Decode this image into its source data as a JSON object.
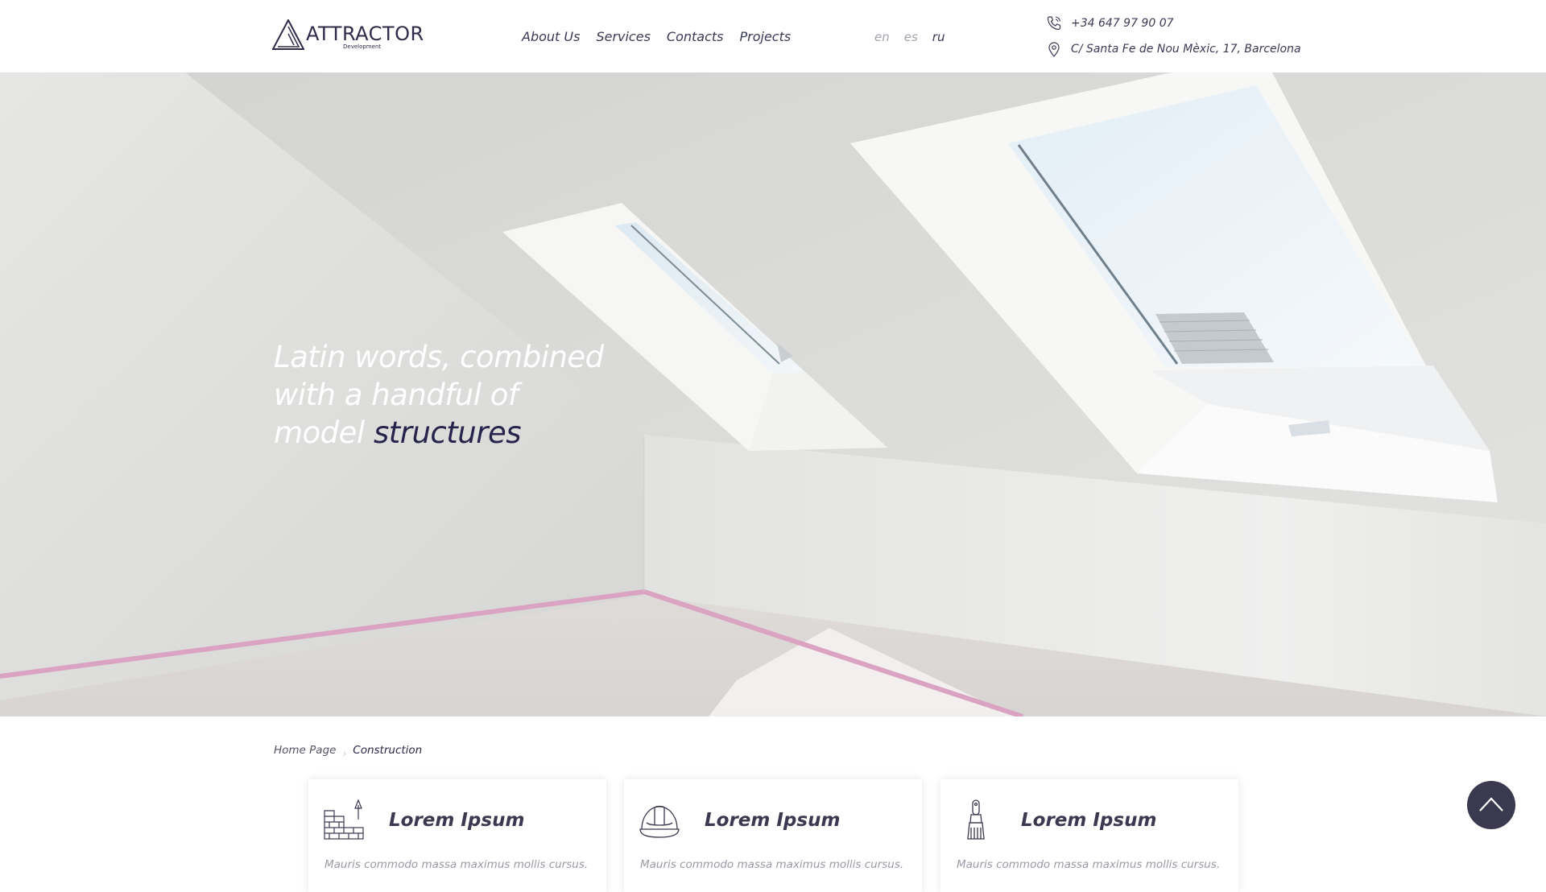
{
  "brand": {
    "name": "ATTRACTOR",
    "subtitle": "Development"
  },
  "nav": {
    "items": [
      {
        "label": "About Us"
      },
      {
        "label": "Services"
      },
      {
        "label": "Contacts"
      },
      {
        "label": "Projects"
      }
    ]
  },
  "languages": {
    "items": [
      {
        "code": "en"
      },
      {
        "code": "es"
      },
      {
        "code": "ru"
      }
    ],
    "active": "ru"
  },
  "contact": {
    "phone": "+34 647 97 90 07",
    "phone_icon": "phone-icon",
    "address": "C/ Santa Fe de Nou Mèxic, 17, Barcelona",
    "address_icon": "location-pin-icon"
  },
  "hero": {
    "line1": "Latin words, combined",
    "line2": "with a handful of",
    "line3_plain": "model",
    "line3_accent": "structures",
    "accent_color": "#26244a"
  },
  "breadcrumb": {
    "home": "Home Page",
    "current": "Construction"
  },
  "cards": [
    {
      "title": "Lorem Ipsum",
      "text": "Mauris commodo massa maximus mollis cursus.",
      "icon": "brick-wall-icon"
    },
    {
      "title": "Lorem Ipsum",
      "text": "Mauris commodo massa maximus mollis cursus.",
      "icon": "hard-hat-icon"
    },
    {
      "title": "Lorem Ipsum",
      "text": "Mauris commodo massa maximus mollis cursus.",
      "icon": "paint-brush-icon"
    }
  ],
  "scroll_top": {
    "icon": "chevron-up-icon",
    "color": "#3a3950"
  }
}
